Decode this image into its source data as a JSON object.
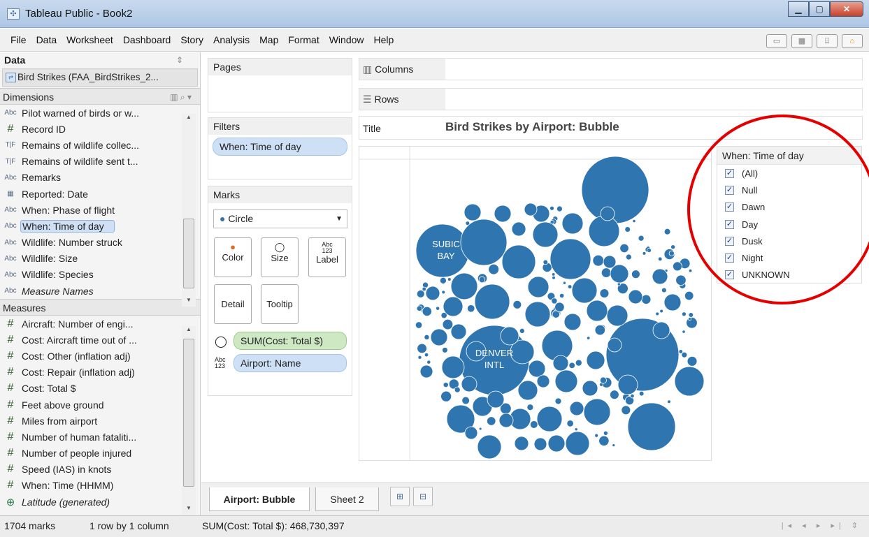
{
  "window": {
    "title": "Tableau Public - Book2"
  },
  "menu": [
    "File",
    "Data",
    "Worksheet",
    "Dashboard",
    "Story",
    "Analysis",
    "Map",
    "Format",
    "Window",
    "Help"
  ],
  "data_pane": {
    "title": "Data",
    "datasource": "Bird Strikes (FAA_BirdStrikes_2...",
    "dimensions_label": "Dimensions",
    "dimensions": [
      {
        "icon": "Abc",
        "name": "Pilot warned of birds or w..."
      },
      {
        "icon": "#",
        "name": "Record ID"
      },
      {
        "icon": "T|F",
        "name": "Remains of wildlife collec..."
      },
      {
        "icon": "T|F",
        "name": "Remains of wildlife sent t..."
      },
      {
        "icon": "Abc",
        "name": "Remarks"
      },
      {
        "icon": "date",
        "name": "Reported: Date"
      },
      {
        "icon": "Abc",
        "name": "When: Phase of flight"
      },
      {
        "icon": "Abc",
        "name": "When: Time of day"
      },
      {
        "icon": "Abc",
        "name": "Wildlife: Number struck"
      },
      {
        "icon": "Abc",
        "name": "Wildlife: Size"
      },
      {
        "icon": "Abc",
        "name": "Wildlife: Species"
      },
      {
        "icon": "Abc",
        "name": "Measure Names"
      }
    ],
    "measures_label": "Measures",
    "measures": [
      {
        "icon": "#",
        "name": "Aircraft: Number of engi..."
      },
      {
        "icon": "#",
        "name": "Cost: Aircraft time out of ..."
      },
      {
        "icon": "#",
        "name": "Cost: Other (inflation adj)"
      },
      {
        "icon": "#",
        "name": "Cost: Repair (inflation adj)"
      },
      {
        "icon": "#",
        "name": "Cost: Total $"
      },
      {
        "icon": "#",
        "name": "Feet above ground"
      },
      {
        "icon": "#",
        "name": "Miles from airport"
      },
      {
        "icon": "#",
        "name": "Number of human fataliti..."
      },
      {
        "icon": "#",
        "name": "Number of people injured"
      },
      {
        "icon": "#",
        "name": "Speed (IAS) in knots"
      },
      {
        "icon": "#",
        "name": "When: Time (HHMM)"
      },
      {
        "icon": "globe",
        "name": "Latitude (generated)"
      }
    ]
  },
  "shelves": {
    "pages": "Pages",
    "filters": "Filters",
    "filter_pill": "When: Time of day",
    "marks": "Marks",
    "mark_type": "Circle",
    "mark_buttons": {
      "color": "Color",
      "size": "Size",
      "label": "Label",
      "detail": "Detail",
      "tooltip": "Tooltip"
    },
    "label_glyph": "Abc\n123",
    "mark_pills": [
      "SUM(Cost: Total $)",
      "Airport: Name"
    ],
    "columns": "Columns",
    "rows": "Rows",
    "title_label": "Title"
  },
  "view": {
    "title": "Bird Strikes by Airport: Bubble",
    "bubble_color": "#2f75b0",
    "labels": [
      {
        "lines": [
          "SUBIC",
          "BAY"
        ]
      },
      {
        "lines": [
          "DENVER",
          "INTL"
        ]
      }
    ]
  },
  "legend": {
    "title": "When: Time of day",
    "items": [
      "(All)",
      "Null",
      "Dawn",
      "Day",
      "Dusk",
      "Night",
      "UNKNOWN"
    ],
    "checked": true
  },
  "tabs": [
    "Airport: Bubble",
    "Sheet 2"
  ],
  "status": {
    "marks": "1704 marks",
    "dims": "1 row by 1 column",
    "sum": "SUM(Cost: Total $): 468,730,397"
  }
}
